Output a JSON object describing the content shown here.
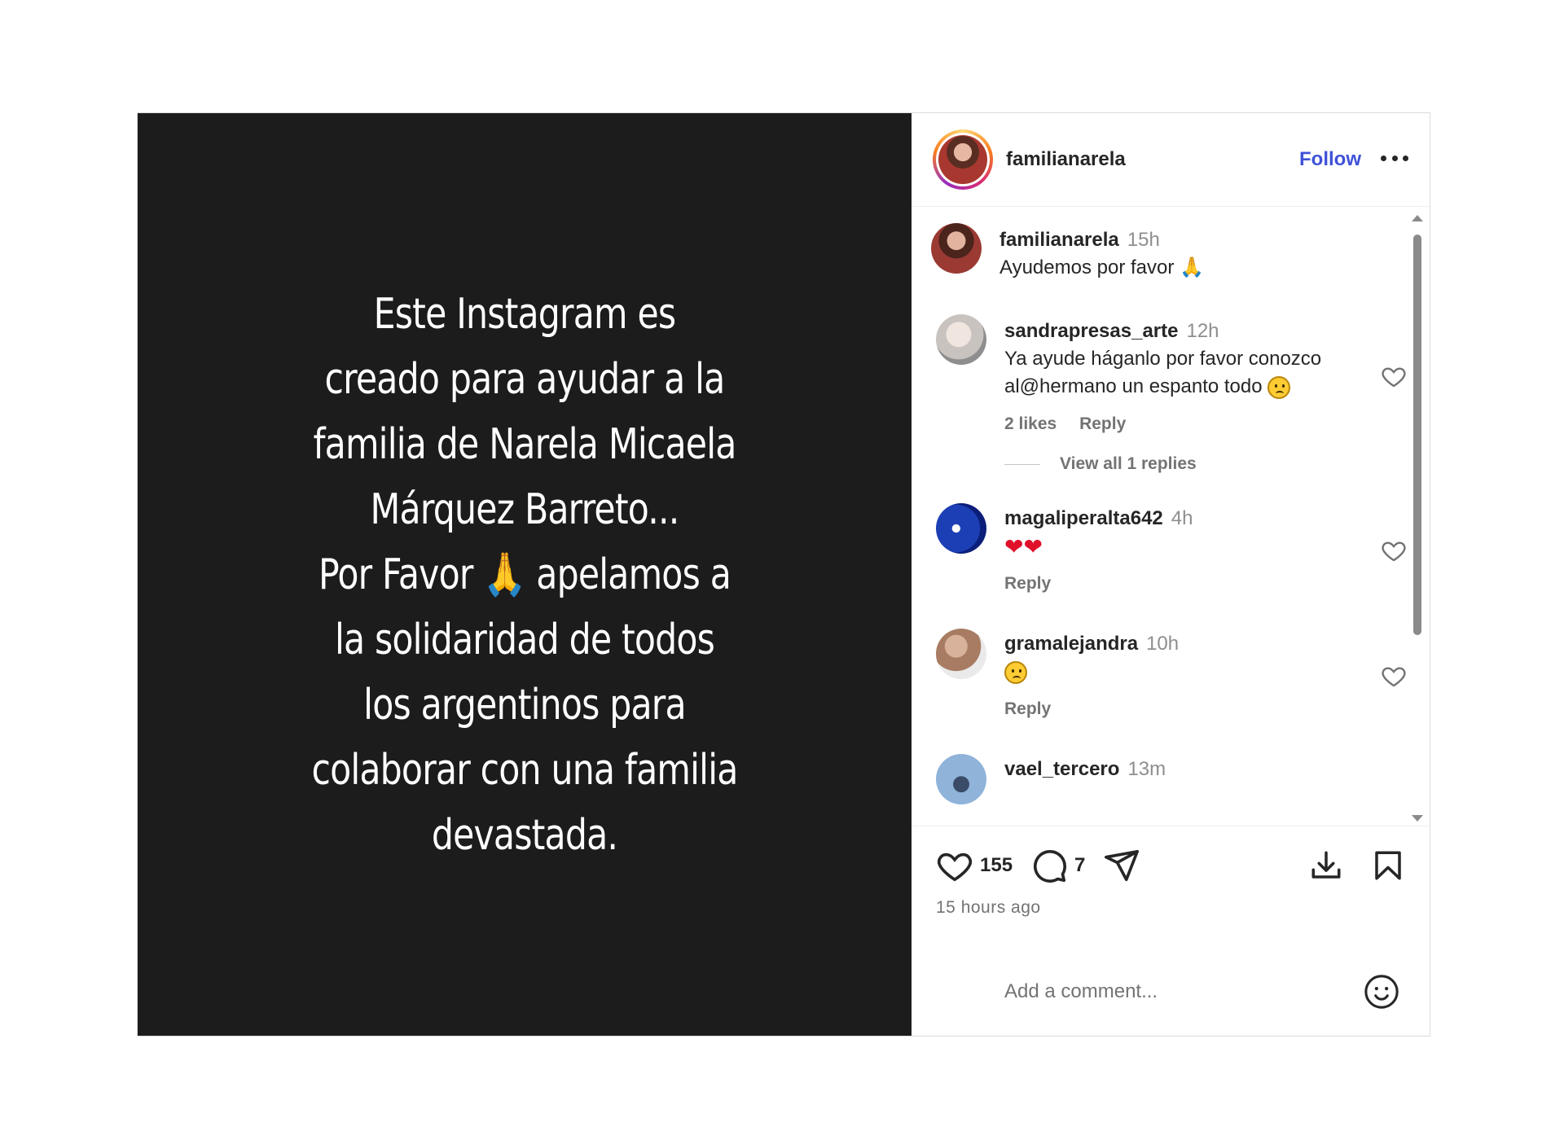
{
  "story": {
    "text": "Este Instagram es\ncreado para ayudar a la\nfamilia de Narela Micaela\nMárquez Barreto...\nPor Favor 🙏 apelamos a\nla solidaridad de todos\nlos argentinos para\ncolaborar con una familia\ndevastada."
  },
  "header": {
    "username": "familianarela",
    "follow_label": "Follow"
  },
  "caption": {
    "username": "familianarela",
    "time": "15h",
    "text": "Ayudemos por favor 🙏"
  },
  "comments": [
    {
      "username": "sandrapresas_arte",
      "time": "12h",
      "text": "Ya ayude háganlo por favor conozco al@hermano un espanto todo",
      "likes": "2 likes",
      "reply": "Reply",
      "view_replies": "View all 1 replies"
    },
    {
      "username": "magaliperalta642",
      "time": "4h",
      "reply": "Reply"
    },
    {
      "username": "gramalejandra",
      "time": "10h",
      "reply": "Reply"
    },
    {
      "username": "vael_tercero",
      "time": "13m"
    }
  ],
  "actions": {
    "likes": "155",
    "comments": "7",
    "time_ago": "15 hours ago"
  },
  "composer": {
    "placeholder": "Add a comment..."
  },
  "icons": [
    "heart-icon",
    "comment-icon",
    "share-icon",
    "download-icon",
    "bookmark-icon",
    "emoji-icon",
    "more-icon"
  ],
  "colors": {
    "media_bg": "#1c1c1c",
    "follow": "#3f51d8",
    "text": "#262626",
    "muted": "#737373"
  }
}
